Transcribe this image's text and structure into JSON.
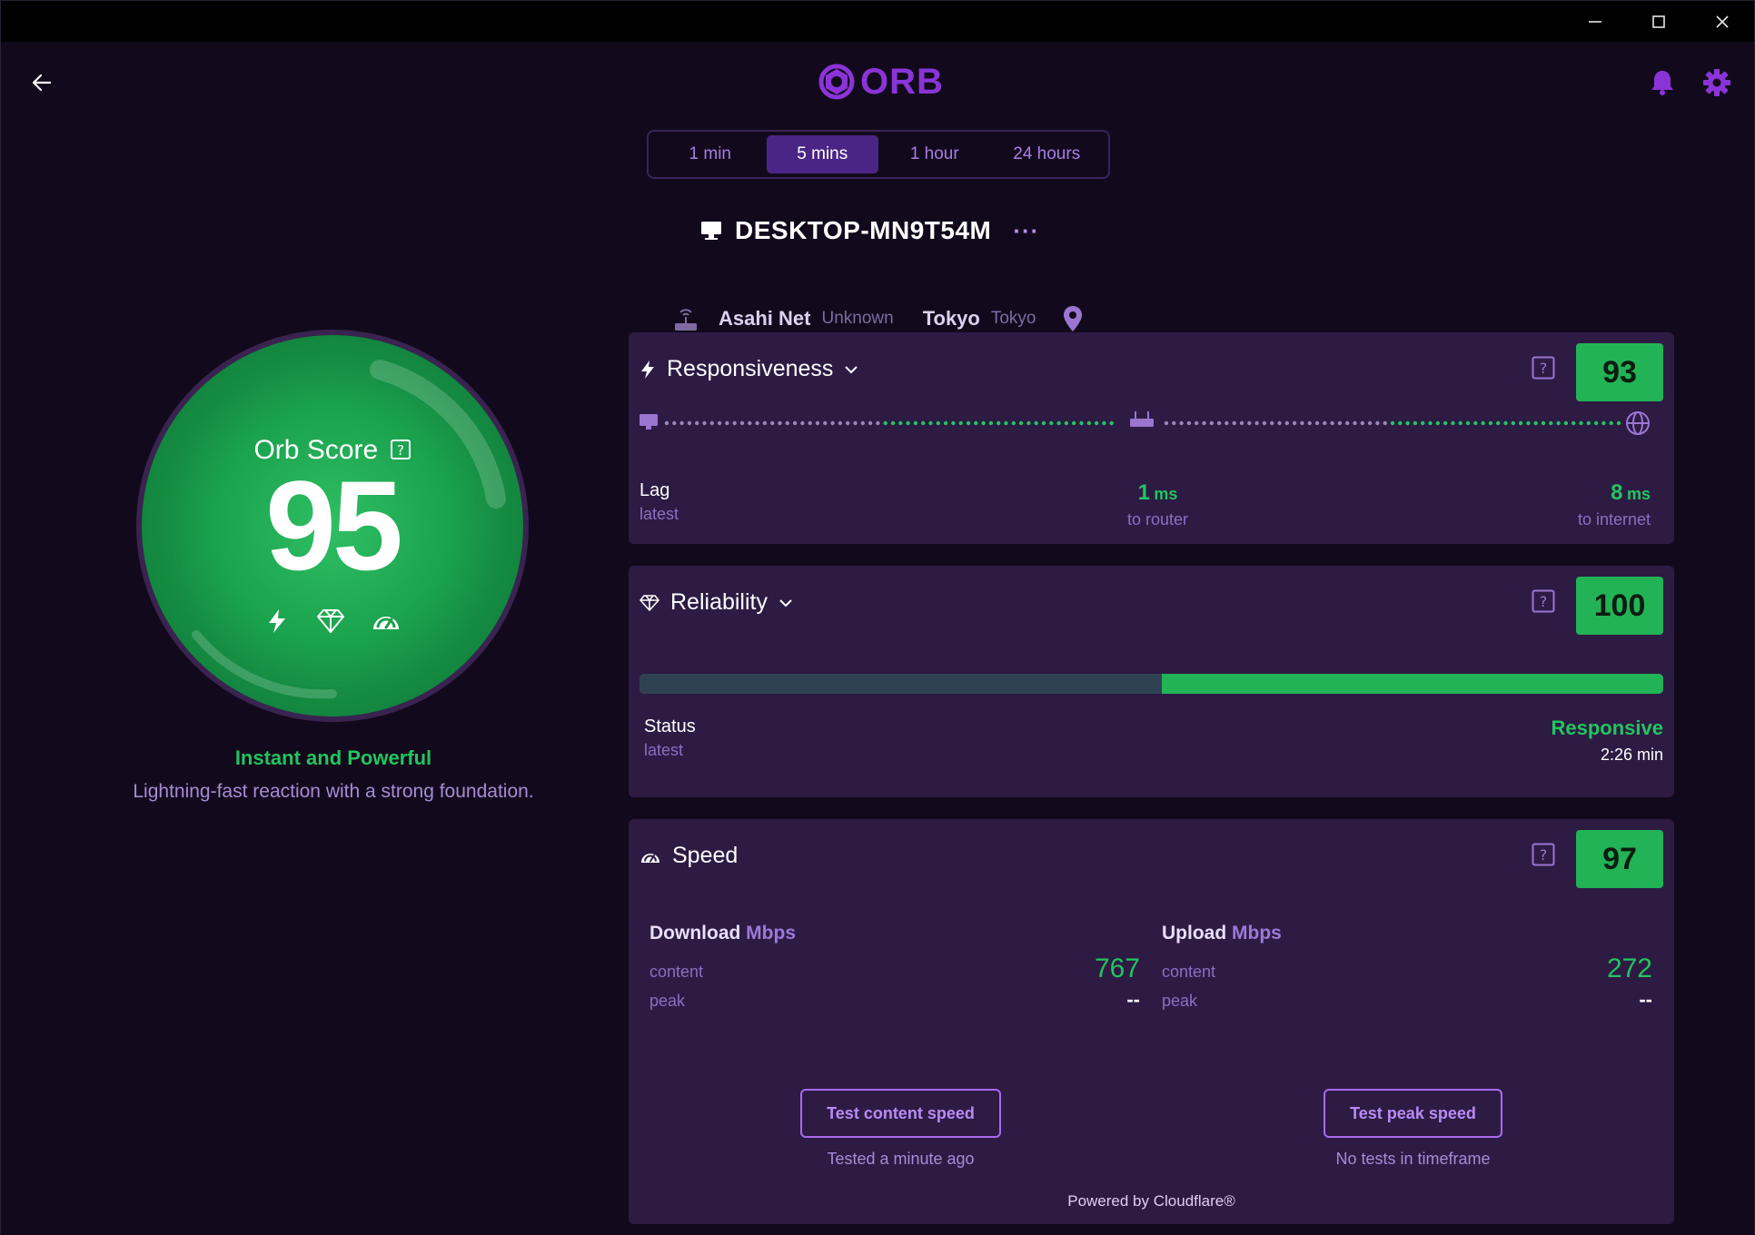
{
  "window": {
    "controls": {
      "minimize": "minimize-icon",
      "maximize": "maximize-icon",
      "close": "close-icon"
    }
  },
  "header": {
    "logo_text": "ORB",
    "icons": [
      "back-arrow-icon",
      "bell-icon",
      "gear-icon"
    ],
    "accent": "#8a34d8"
  },
  "timeframe": {
    "options": [
      "1 min",
      "5 mins",
      "1 hour",
      "24 hours"
    ],
    "selected": "5 mins"
  },
  "device": {
    "name": "DESKTOP-MN9T54M",
    "more": "···",
    "isp": "Asahi Net",
    "isp_sub": "Unknown",
    "city": "Tokyo",
    "city_sub": "Tokyo"
  },
  "orb": {
    "title": "Orb Score",
    "score": "95",
    "tagline": "Instant and Powerful",
    "description": "Lightning-fast reaction with a strong foundation."
  },
  "responsiveness": {
    "title": "Responsiveness",
    "score": "93",
    "lag_label": "Lag",
    "lag_sub": "latest",
    "router_value": "1",
    "router_unit": "ms",
    "router_label": "to router",
    "internet_value": "8",
    "internet_unit": "ms",
    "internet_label": "to internet"
  },
  "reliability": {
    "title": "Reliability",
    "score": "100",
    "status_label": "Status",
    "status_sub": "latest",
    "status_value": "Responsive",
    "status_time": "2:26 min",
    "bar_good_fraction": 0.49
  },
  "speed": {
    "title": "Speed",
    "score": "97",
    "download": {
      "label": "Download",
      "unit": "Mbps",
      "content_label": "content",
      "content_value": "767",
      "peak_label": "peak",
      "peak_value": "--"
    },
    "upload": {
      "label": "Upload",
      "unit": "Mbps",
      "content_label": "content",
      "content_value": "272",
      "peak_label": "peak",
      "peak_value": "--"
    },
    "test_content_button": "Test content speed",
    "test_content_note": "Tested a minute ago",
    "test_peak_button": "Test peak speed",
    "test_peak_note": "No tests in timeframe",
    "powered_by": "Powered by Cloudflare®"
  },
  "colors": {
    "good": "#22c55e",
    "card": "#2d1b44",
    "background": "#120a1c"
  }
}
